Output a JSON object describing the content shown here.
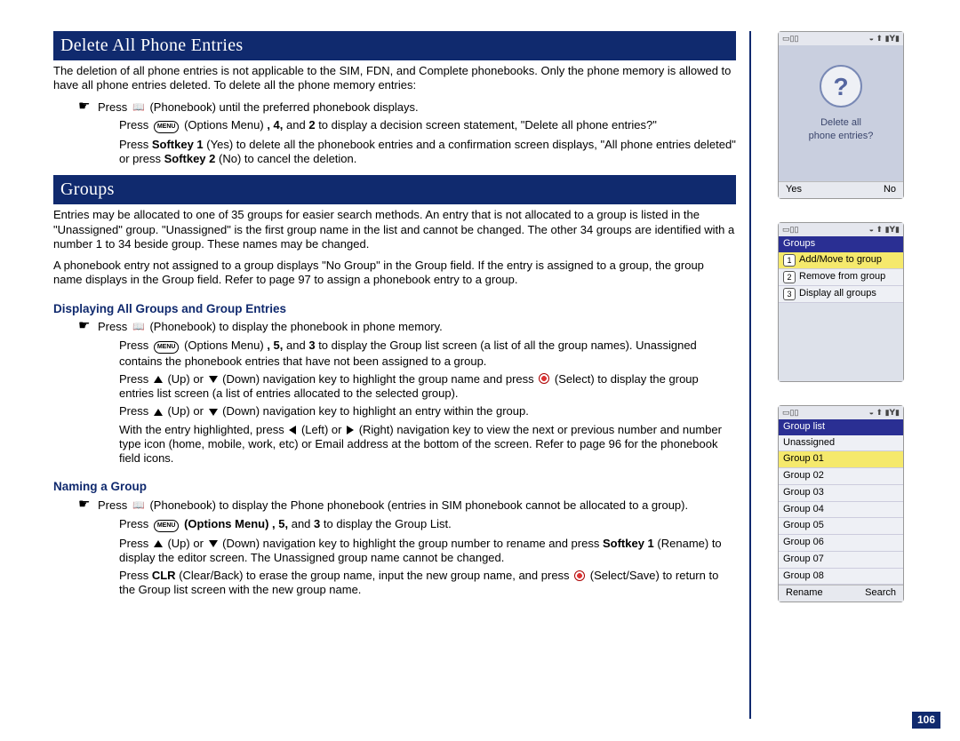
{
  "page_number": "106",
  "headings": {
    "delete_all": "Delete All Phone Entries",
    "groups": "Groups"
  },
  "subheads": {
    "display_groups": "Displaying All Groups and Group Entries",
    "naming_group": "Naming a Group"
  },
  "glyph_labels": {
    "menu": "MENU"
  },
  "delete_section": {
    "intro": "The deletion of all phone entries is not applicable to the SIM, FDN, and Complete phonebooks. Only the phone memory is allowed to have all phone entries deleted. To delete all the phone memory entries:",
    "b1_prefix": "Press ",
    "b1_suffix": " (Phonebook) until the preferred phonebook displays.",
    "b2_prefix": "Press ",
    "b2_mid1": " (Options Menu)",
    "b2_bold1": ", 4,",
    "b2_mid2": " and ",
    "b2_bold2": "2",
    "b2_suffix": " to display a decision screen statement, \"Delete all phone entries?\"",
    "b3_prefix": "Press ",
    "b3_bold1": "Softkey 1",
    "b3_mid": " (Yes) to delete all the phonebook entries and a confirmation screen displays, \"All phone entries deleted\" or press ",
    "b3_bold2": "Softkey 2",
    "b3_suffix": " (No) to cancel the deletion."
  },
  "groups_section": {
    "p1": "Entries may be allocated to one of 35 groups for easier search methods. An entry that is not allocated to a group is listed in the \"Unassigned\" group. \"Unassigned\" is the first group name in the list and cannot be changed. The other 34 groups are identified with a number 1 to 34 beside group. These names may be changed.",
    "p2": " A phonebook entry not assigned to a group displays \"No Group\" in the Group field. If the entry is assigned to a group, the group name displays in the Group field. Refer to page 97 to assign a phonebook entry to a group."
  },
  "display_groups": {
    "b1_prefix": "Press ",
    "b1_suffix": " (Phonebook) to display the phonebook in phone memory.",
    "b2_prefix": "Press ",
    "b2_mid1": " (Options Menu)",
    "b2_bold1": ", 5,",
    "b2_mid2": " and ",
    "b2_bold2": "3",
    "b2_suffix": " to display the Group list screen (a list of all the group names). Unassigned contains the phonebook entries that have not been assigned to a group.",
    "b3_prefix": "Press ",
    "b3_mid1": " (Up) or ",
    "b3_mid2": " (Down) navigation key to highlight the group name and press ",
    "b3_suffix": " (Select) to display the group entries list screen (a list of entries allocated to the selected group).",
    "b4_prefix": "Press ",
    "b4_mid1": " (Up) or ",
    "b4_suffix": " (Down) navigation key to highlight an entry within the group.",
    "b5_prefix": "With the entry highlighted, press ",
    "b5_mid1": " (Left) or ",
    "b5_suffix": " (Right) navigation key to view the next or previous number and number type icon (home, mobile, work, etc) or Email address at the bottom of the screen. Refer to page 96 for the phonebook field icons."
  },
  "naming_group": {
    "b1_prefix": "Press ",
    "b1_suffix": " (Phonebook) to display the Phone phonebook (entries in SIM phonebook cannot be allocated to a group).",
    "b2_prefix": "Press ",
    "b2_bold": " (Options Menu) , 5,",
    "b2_mid": " and ",
    "b2_bold2": "3",
    "b2_suffix": " to display the Group List.",
    "b3_prefix": "Press ",
    "b3_mid1": " (Up) or ",
    "b3_mid2": " (Down) navigation key to highlight the group number to rename and press ",
    "b3_bold": "Softkey 1",
    "b3_suffix": " (Rename) to display the editor screen. The Unassigned group name cannot be changed.",
    "b4_prefix": "Press ",
    "b4_bold": "CLR",
    "b4_mid": " (Clear/Back) to erase the group name, input the new group name, and press ",
    "b4_suffix": " (Select/Save) to return to the Group list screen with the new group name."
  },
  "phone1": {
    "text1": "Delete all",
    "text2": "phone entries?",
    "soft_l": "Yes",
    "soft_r": "No"
  },
  "phone2": {
    "title": "Groups",
    "items": [
      {
        "n": "1",
        "t": "Add/Move to group",
        "hl": true
      },
      {
        "n": "2",
        "t": "Remove from group",
        "hl": false
      },
      {
        "n": "3",
        "t": "Display all groups",
        "hl": false
      }
    ]
  },
  "phone3": {
    "title": "Group list",
    "items": [
      {
        "t": "Unassigned",
        "hl": false
      },
      {
        "t": "Group 01",
        "hl": true
      },
      {
        "t": "Group 02",
        "hl": false
      },
      {
        "t": "Group 03",
        "hl": false
      },
      {
        "t": "Group 04",
        "hl": false
      },
      {
        "t": "Group 05",
        "hl": false
      },
      {
        "t": "Group 06",
        "hl": false
      },
      {
        "t": "Group 07",
        "hl": false
      },
      {
        "t": "Group 08",
        "hl": false
      }
    ],
    "soft_l": "Rename",
    "soft_r": "Search"
  }
}
